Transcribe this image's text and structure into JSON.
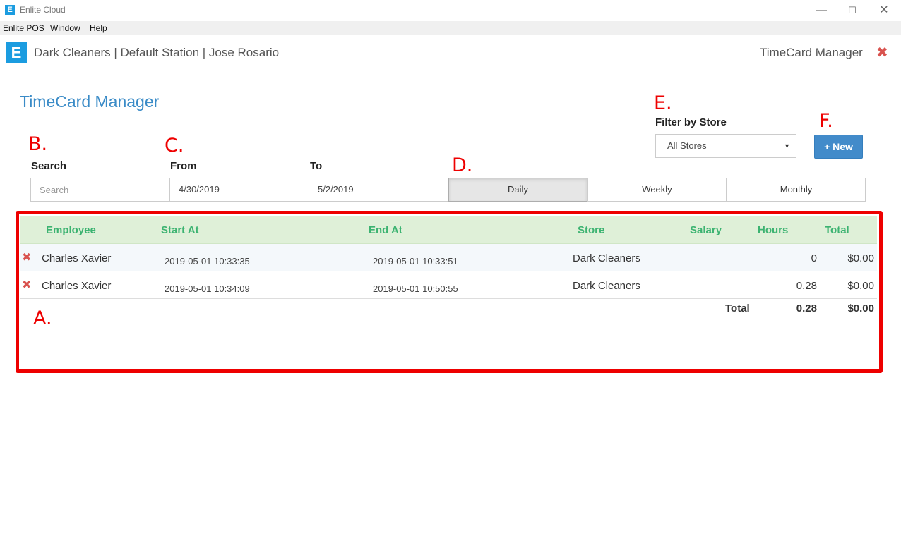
{
  "window": {
    "title": "Enlite Cloud",
    "logo_letter": "E",
    "minimize": "—",
    "maximize": "☐",
    "close": "✕"
  },
  "menu": [
    "Enlite POS",
    "Window",
    "Help"
  ],
  "header": {
    "logo_letter": "E",
    "title": "Dark Cleaners | Default Station | Jose Rosario",
    "module": "TimeCard Manager",
    "close": "✖"
  },
  "page": {
    "title": "TimeCard Manager"
  },
  "annotations": {
    "a": "A.",
    "b": "B.",
    "c": "C.",
    "d": "D.",
    "e": "E.",
    "f": "F."
  },
  "filters": {
    "search_label": "Search",
    "search_placeholder": "Search",
    "from_label": "From",
    "from_value": "4/30/2019",
    "to_label": "To",
    "to_value": "5/2/2019",
    "periods": [
      "Daily",
      "Weekly",
      "Monthly"
    ],
    "active_period": "Daily",
    "store_label": "Filter by Store",
    "store_value": "All Stores",
    "new_button": "+ New"
  },
  "table": {
    "headers": [
      "Employee",
      "Start At",
      "End At",
      "Store",
      "Salary",
      "Hours",
      "Total"
    ],
    "rows": [
      {
        "employee": "Charles Xavier",
        "start": "2019-05-01 10:33:35",
        "end": "2019-05-01 10:33:51",
        "store": "Dark Cleaners",
        "salary": "",
        "hours": "0",
        "total": "$0.00"
      },
      {
        "employee": "Charles Xavier",
        "start": "2019-05-01 10:34:09",
        "end": "2019-05-01 10:50:55",
        "store": "Dark Cleaners",
        "salary": "",
        "hours": "0.28",
        "total": "$0.00"
      }
    ],
    "footer": {
      "label": "Total",
      "hours": "0.28",
      "total": "$0.00"
    }
  },
  "colors": {
    "brand": "#1b9ce0",
    "title_blue": "#3a8bc7",
    "header_green": "#3cb371",
    "header_bg": "#dff0d8",
    "danger": "#d9534f",
    "primary_button": "#428bca",
    "annotation_red": "#ee0000"
  }
}
